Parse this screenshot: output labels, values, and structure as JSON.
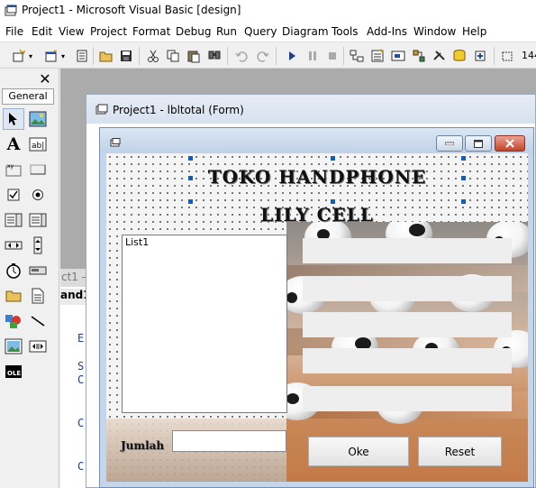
{
  "app": {
    "title": "Project1 - Microsoft Visual Basic [design]"
  },
  "menu": [
    "File",
    "Edit",
    "View",
    "Project",
    "Format",
    "Debug",
    "Run",
    "Query",
    "Diagram",
    "Tools",
    "Add-Ins",
    "Window",
    "Help"
  ],
  "toolbar": {
    "icons": [
      "add-project-icon",
      "add-form-icon",
      "menu-editor-icon",
      "open-project-icon",
      "save-project-icon",
      "cut-icon",
      "copy-icon",
      "paste-icon",
      "find-icon",
      "undo-icon",
      "redo-icon",
      "start-icon",
      "break-icon",
      "end-icon",
      "project-explorer-icon",
      "properties-window-icon",
      "form-layout-icon",
      "object-browser-icon",
      "toolbox-icon",
      "data-view-icon",
      "component-manager-icon"
    ],
    "coord_text": "144"
  },
  "toolbox": {
    "close_label": "✕",
    "tab_label": "General",
    "tools": [
      "pointer-icon",
      "picturebox-icon",
      "label-icon",
      "textbox-icon",
      "frame-icon",
      "commandbutton-icon",
      "checkbox-icon",
      "optionbutton-icon",
      "combobox-icon",
      "listbox-icon",
      "hscrollbar-icon",
      "vscrollbar-icon",
      "timer-icon",
      "drivelistbox-icon",
      "dirlistbox-icon",
      "filelistbox-icon",
      "shape-icon",
      "line-icon",
      "image-icon",
      "data-icon",
      "ole-icon"
    ]
  },
  "background_window": {
    "title_fragment": "ct1 -",
    "tab_fragment": "and1",
    "code_lines": [
      "E",
      "S",
      "C",
      "C",
      "C"
    ]
  },
  "designer": {
    "title": "Project1 - lbltotal (Form)"
  },
  "form": {
    "heading1": "TOKO HANDPHONE",
    "heading2": "LILY CELL",
    "list_text": "List1",
    "jumlah_label": "Jumlah",
    "button_oke": "Oke",
    "button_reset": "Reset",
    "textbox_count": 5
  },
  "colors": {
    "form_border": "#6f8fb5",
    "selection_handle": "#0a5fc8",
    "close_button": "#c2432b"
  }
}
